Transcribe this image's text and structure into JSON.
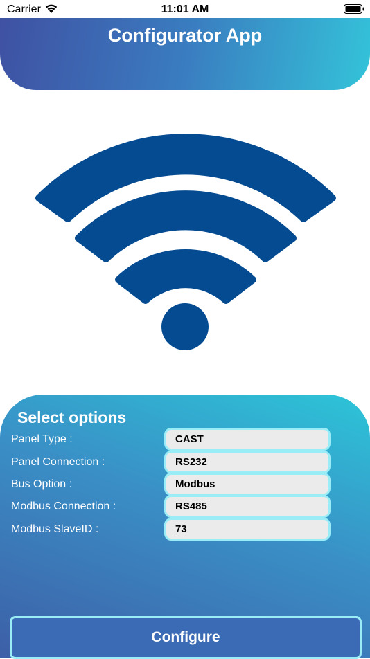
{
  "status_bar": {
    "carrier": "Carrier",
    "time": "11:01 AM"
  },
  "header": {
    "title": "Configurator App"
  },
  "hero": {
    "icon": "wifi-icon",
    "color": "#054b92"
  },
  "options": {
    "title": "Select options",
    "rows": [
      {
        "label": "Panel Type :",
        "value": "CAST"
      },
      {
        "label": "Panel Connection :",
        "value": "RS232"
      },
      {
        "label": "Bus Option :",
        "value": "Modbus"
      },
      {
        "label": "Modbus Connection :",
        "value": "RS485"
      },
      {
        "label": "Modbus SlaveID :",
        "value": "73"
      }
    ]
  },
  "configure": {
    "label": "Configure"
  },
  "colors": {
    "accent_start": "#3f51a3",
    "accent_end": "#34c3d9",
    "field_border": "#9aecf7",
    "button": "#3a6bb4"
  }
}
